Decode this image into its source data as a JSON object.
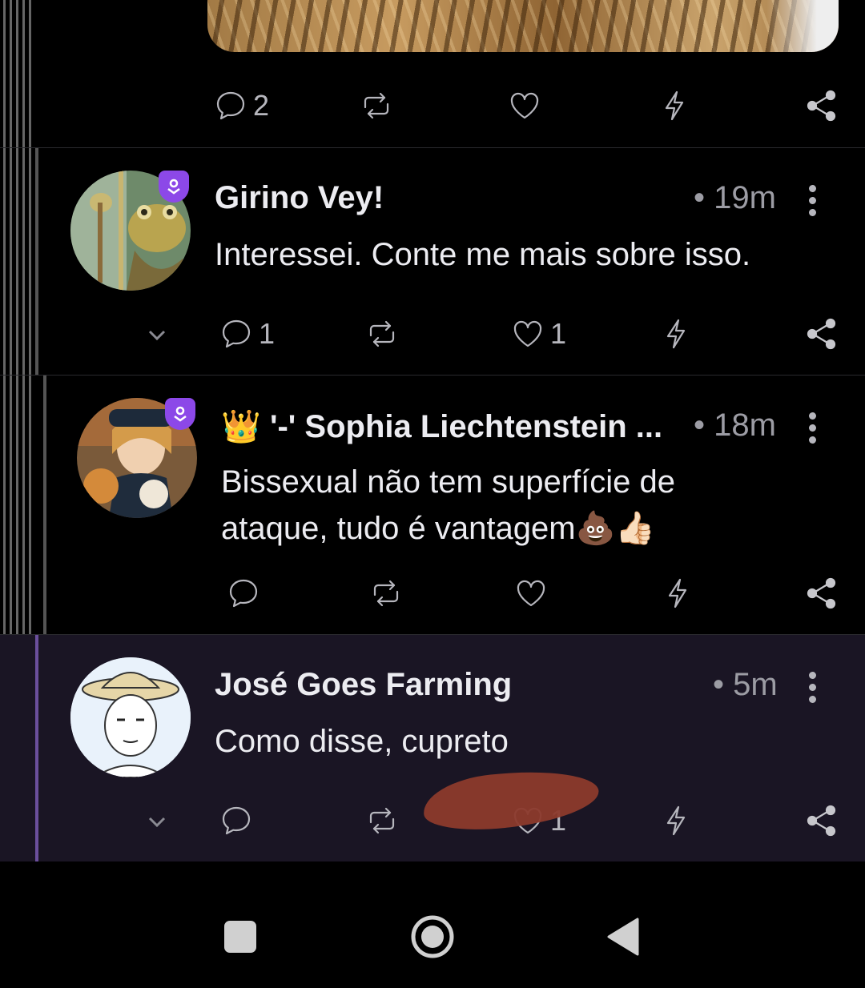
{
  "top_post": {
    "actions": {
      "reply_count": "2",
      "repost_count": "",
      "like_count": ""
    }
  },
  "posts": [
    {
      "name": "Girino Vey!",
      "time": "• 19m",
      "body": "Interessei. Conte me mais sobre isso.",
      "reply_count": "1",
      "like_count": "1"
    },
    {
      "crown": "👑",
      "name": "'-' Sophia Liechtenstein ...",
      "time": "• 18m",
      "body_line1": "Bissexual não tem superfície de",
      "body_line2": "ataque, tudo é vantagem💩👍🏻",
      "reply_count": "",
      "like_count": ""
    },
    {
      "name": "José Goes Farming",
      "time": "• 5m",
      "body": "Como disse, cupreto",
      "reply_count": "",
      "like_count": "1"
    }
  ],
  "icons": {
    "reply": "comment-icon",
    "repost": "repost-icon",
    "like": "heart-icon",
    "zap": "lightning-icon",
    "share": "share-icon",
    "expand": "chevron-down-icon",
    "badge": "verified-shield-icon"
  },
  "colors": {
    "background": "#000000",
    "highlight_background": "#1a1524",
    "badge": "#8c48e8",
    "text_primary": "#ececf1",
    "text_secondary": "#9c9ca4",
    "redaction": "#8c3a2c"
  }
}
